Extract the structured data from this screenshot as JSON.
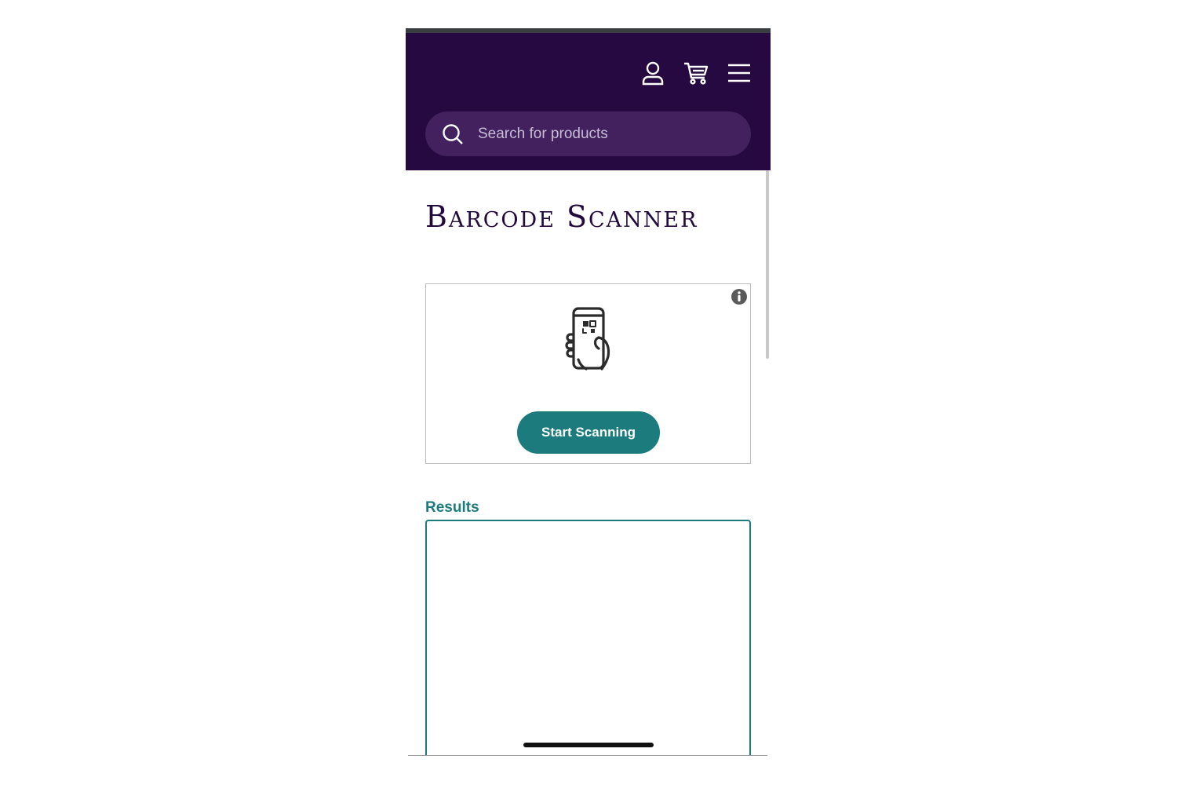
{
  "header": {
    "account_icon": "user-account-icon",
    "cart_icon": "shopping-cart-icon",
    "menu_icon": "hamburger-menu-icon",
    "background_color": "#260940"
  },
  "search": {
    "placeholder": "Search for products",
    "icon": "search-icon"
  },
  "page": {
    "title": "Barcode Scanner"
  },
  "scanner": {
    "illustration_icon": "phone-scan-icon",
    "info_icon": "info-icon",
    "start_button_label": "Start Scanning",
    "accent_color": "#1c7c7d"
  },
  "results": {
    "label": "Results",
    "value": ""
  }
}
